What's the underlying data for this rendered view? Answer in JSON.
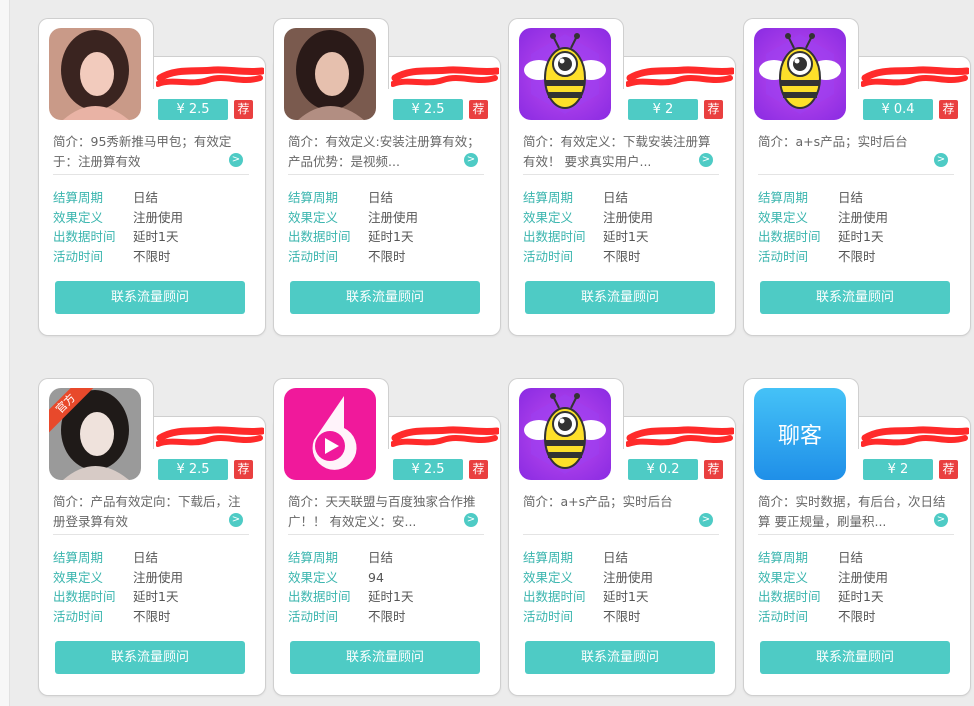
{
  "colors": {
    "accent": "#4ecbc5",
    "recommend": "#e94040",
    "label": "#3ab5ae",
    "redaction": "#ff2a2a"
  },
  "cards": [
    {
      "image": "woman-photo-1",
      "price": "¥ 2.5",
      "recommend": "荐",
      "desc": "简介：95秀新推马甲包；有效定于：注册算有效",
      "rows": [
        {
          "k": "结算周期",
          "v": "日结"
        },
        {
          "k": "效果定义",
          "v": "注册使用"
        },
        {
          "k": "出数据时间",
          "v": "延时1天"
        },
        {
          "k": "活动时间",
          "v": "不限时"
        }
      ],
      "button": "联系流量顾问"
    },
    {
      "image": "woman-photo-2",
      "price": "¥ 2.5",
      "recommend": "荐",
      "desc": "简介：有效定义:安装注册算有效；产品优势：是视频...",
      "rows": [
        {
          "k": "结算周期",
          "v": "日结"
        },
        {
          "k": "效果定义",
          "v": "注册使用"
        },
        {
          "k": "出数据时间",
          "v": "延时1天"
        },
        {
          "k": "活动时间",
          "v": "不限时"
        }
      ],
      "button": "联系流量顾问"
    },
    {
      "image": "bee-app-icon",
      "price": "¥ 2",
      "recommend": "荐",
      "desc": "简介：有效定义：下载安装注册算有效！ 要求真实用户...",
      "rows": [
        {
          "k": "结算周期",
          "v": "日结"
        },
        {
          "k": "效果定义",
          "v": "注册使用"
        },
        {
          "k": "出数据时间",
          "v": "延时1天"
        },
        {
          "k": "活动时间",
          "v": "不限时"
        }
      ],
      "button": "联系流量顾问"
    },
    {
      "image": "bee-app-icon",
      "price": "¥ 0.4",
      "recommend": "荐",
      "desc": "简介：a+s产品；实时后台",
      "rows": [
        {
          "k": "结算周期",
          "v": "日结"
        },
        {
          "k": "效果定义",
          "v": "注册使用"
        },
        {
          "k": "出数据时间",
          "v": "延时1天"
        },
        {
          "k": "活动时间",
          "v": "不限时"
        }
      ],
      "button": "联系流量顾问"
    },
    {
      "image": "woman-photo-3",
      "ribbon": "官方",
      "price": "¥ 2.5",
      "recommend": "荐",
      "desc": "简介：产品有效定向：下载后，注册登录算有效",
      "rows": [
        {
          "k": "结算周期",
          "v": "日结"
        },
        {
          "k": "效果定义",
          "v": "注册使用"
        },
        {
          "k": "出数据时间",
          "v": "延时1天"
        },
        {
          "k": "活动时间",
          "v": "不限时"
        }
      ],
      "button": "联系流量顾问"
    },
    {
      "image": "video-app-icon",
      "price": "¥ 2.5",
      "recommend": "荐",
      "desc": "简介：天天联盟与百度独家合作推广！！ 有效定义：安...",
      "rows": [
        {
          "k": "结算周期",
          "v": "日结"
        },
        {
          "k": "效果定义",
          "v": "94"
        },
        {
          "k": "出数据时间",
          "v": "延时1天"
        },
        {
          "k": "活动时间",
          "v": "不限时"
        }
      ],
      "button": "联系流量顾问"
    },
    {
      "image": "bee-app-icon",
      "price": "¥ 0.2",
      "recommend": "荐",
      "desc": "简介：a+s产品；实时后台",
      "rows": [
        {
          "k": "结算周期",
          "v": "日结"
        },
        {
          "k": "效果定义",
          "v": "注册使用"
        },
        {
          "k": "出数据时间",
          "v": "延时1天"
        },
        {
          "k": "活动时间",
          "v": "不限时"
        }
      ],
      "button": "联系流量顾问"
    },
    {
      "image": "chat-app-icon",
      "icon_text": "聊客",
      "price": "¥ 2",
      "recommend": "荐",
      "desc": "简介：实时数据，有后台，次日结算 要正规量，刷量积...",
      "rows": [
        {
          "k": "结算周期",
          "v": "日结"
        },
        {
          "k": "效果定义",
          "v": "注册使用"
        },
        {
          "k": "出数据时间",
          "v": "延时1天"
        },
        {
          "k": "活动时间",
          "v": "不限时"
        }
      ],
      "button": "联系流量顾问"
    }
  ]
}
